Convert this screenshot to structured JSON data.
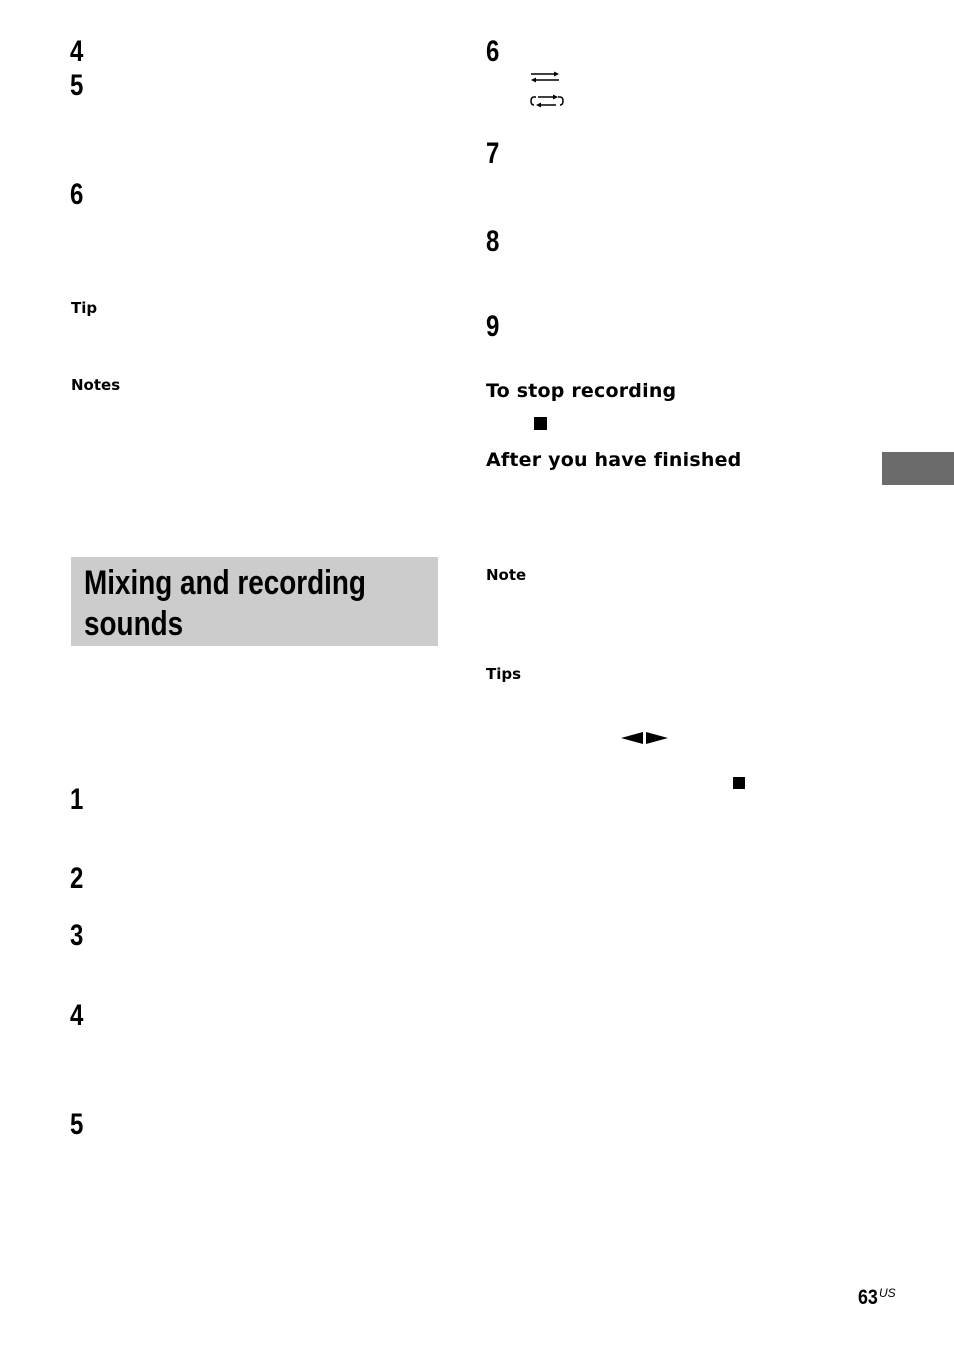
{
  "left_column": {
    "steps_top": [
      "4",
      "5",
      "6"
    ],
    "tip_label": "Tip",
    "notes_label": "Notes",
    "section_title_line1": "Mixing and recording",
    "section_title_line2": "sounds",
    "steps_bottom": [
      "1",
      "2",
      "3",
      "4",
      "5"
    ]
  },
  "right_column": {
    "steps": [
      "6",
      "7",
      "8",
      "9"
    ],
    "icons": [
      "repeat-arrows-icon",
      "repeat-loop-icon",
      "stop-icon",
      "play-direction-icon",
      "stop-icon"
    ],
    "stop_recording_heading": "To stop recording",
    "after_finished_heading": "After you have finished",
    "note_label": "Note",
    "tips_label": "Tips",
    "left_arrow_glyph": "◄",
    "right_arrow_glyph": "►"
  },
  "footer": {
    "page_number": "63",
    "page_suffix": "US"
  }
}
